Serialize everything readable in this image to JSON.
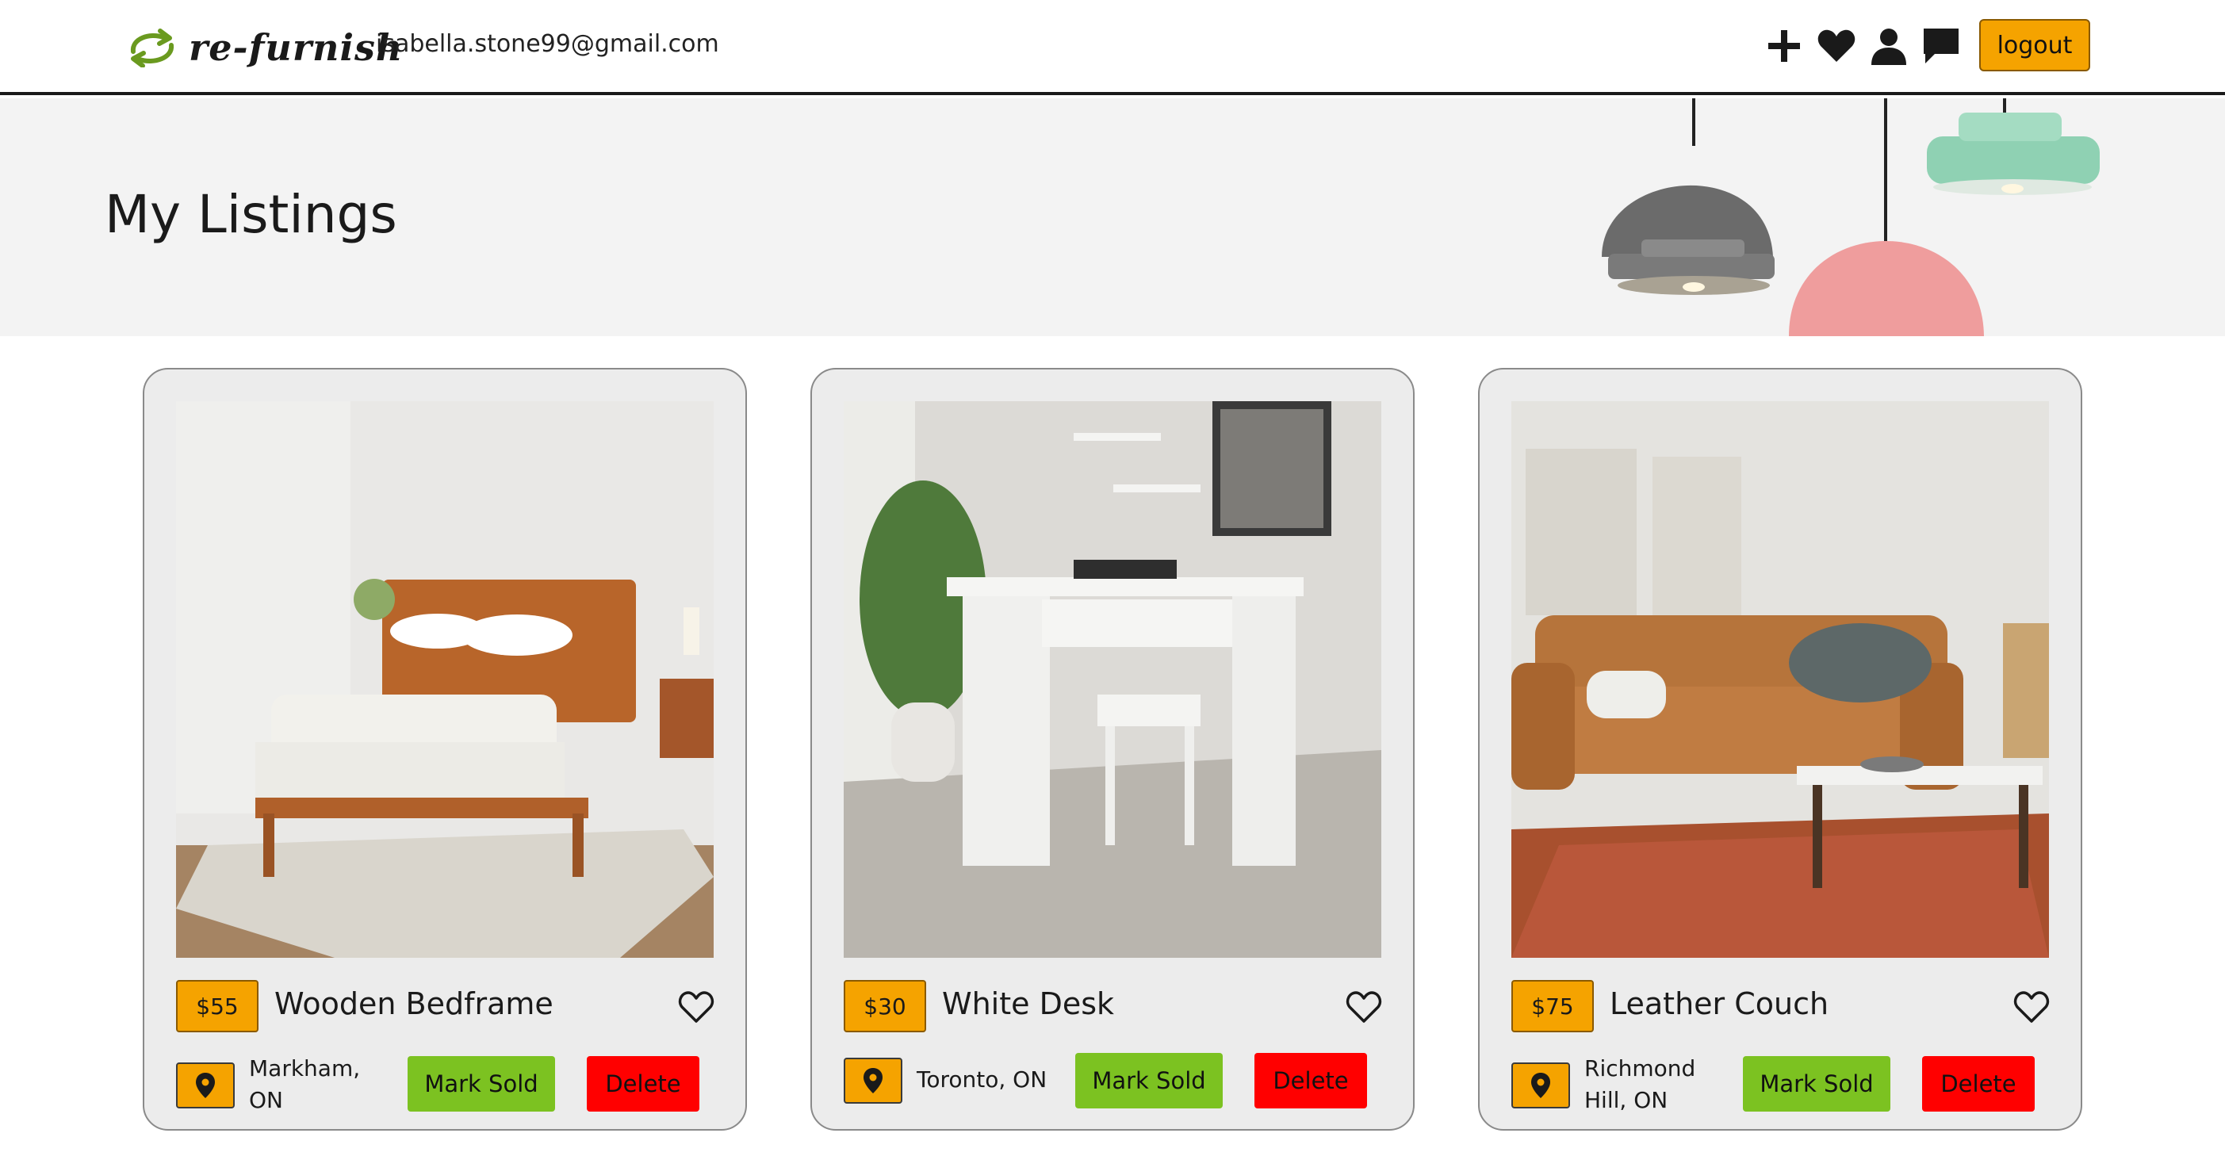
{
  "header": {
    "logo_text": "re-furnish",
    "user_email": "isabella.stone99@gmail.com",
    "icons": [
      "add-icon",
      "heart-icon",
      "user-icon",
      "chat-icon"
    ],
    "logout_label": "logout"
  },
  "banner": {
    "title": "My Listings"
  },
  "listings": [
    {
      "price": "$55",
      "title": "Wooden Bedframe",
      "location": "Markham, ON",
      "mark_sold_label": "Mark Sold",
      "delete_label": "Delete"
    },
    {
      "price": "$30",
      "title": "White Desk",
      "location": "Toronto, ON",
      "mark_sold_label": "Mark Sold",
      "delete_label": "Delete"
    },
    {
      "price": "$75",
      "title": "Leather Couch",
      "location": "Richmond Hill, ON",
      "mark_sold_label": "Mark Sold",
      "delete_label": "Delete"
    }
  ],
  "colors": {
    "accent_orange": "#f5a300",
    "mark_sold_green": "#7cc221",
    "delete_red": "#ff0000",
    "card_bg": "#ececec",
    "banner_bg": "#f3f3f3"
  }
}
